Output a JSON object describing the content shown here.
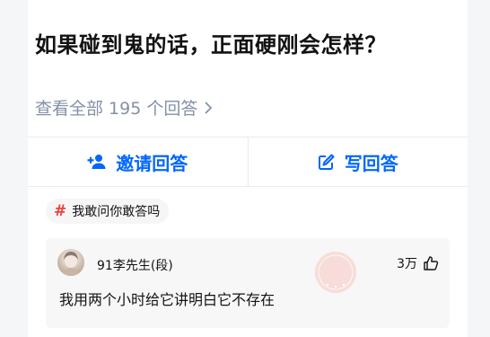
{
  "question": {
    "title": "如果碰到鬼的话，正面硬刚会怎样？",
    "view_all": "查看全部 195 个回答"
  },
  "actions": {
    "invite_label": "邀请回答",
    "write_label": "写回答"
  },
  "topic": {
    "label": "我敢问你敢答吗"
  },
  "answer": {
    "author": "91李先生(段)",
    "likes": "3万",
    "text": "我用两个小时给它讲明白它不存在"
  },
  "colors": {
    "accent": "#0066ff",
    "topic_hash": "#f1403c",
    "muted": "#8590a6",
    "watermark": "#f7c9c6"
  }
}
